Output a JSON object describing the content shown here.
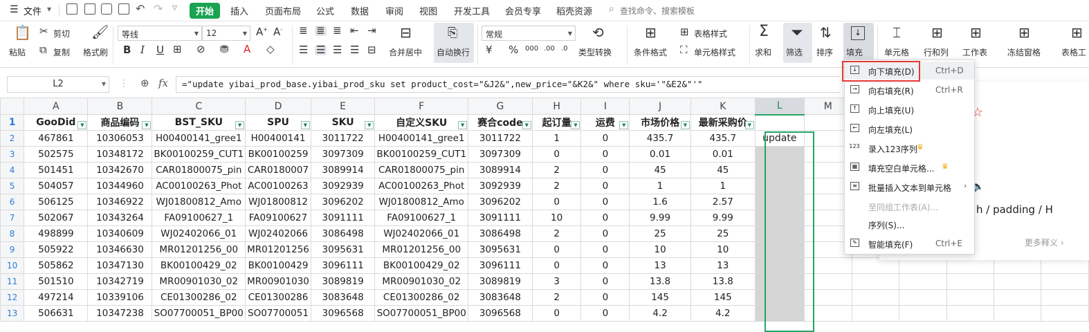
{
  "menubar": {
    "file_label": "文件",
    "tabs": [
      {
        "label": "开始",
        "active": true
      },
      {
        "label": "插入"
      },
      {
        "label": "页面布局"
      },
      {
        "label": "公式"
      },
      {
        "label": "数据"
      },
      {
        "label": "审阅"
      },
      {
        "label": "视图"
      },
      {
        "label": "开发工具"
      },
      {
        "label": "会员专享"
      },
      {
        "label": "稻壳资源"
      }
    ],
    "search_placeholder": "查找命令、搜索模板",
    "accent": "#1aa350"
  },
  "ribbon": {
    "paste": "粘贴",
    "cut": "剪切",
    "copy": "复制",
    "format_painter": "格式刷",
    "font_name": "等线",
    "font_size": "12",
    "merge": "合并居中",
    "wrap": "自动换行",
    "number_format": "常规",
    "type_convert": "类型转换",
    "cond_format": "条件格式",
    "table_style": "表格样式",
    "cell_style": "单元格样式",
    "sum": "求和",
    "filter": "筛选",
    "sort": "排序",
    "fill": "填充",
    "cell": "单元格",
    "row_col": "行和列",
    "worksheet": "工作表",
    "freeze": "冻结窗格",
    "table_tools": "表格工"
  },
  "formula_bar": {
    "name_box": "L2",
    "fx": "fx",
    "formula": "=\"update yibai_prod_base.yibai_prod_sku set product_cost=\"&J2&\",new_price=\"&K2&\" where sku='\"&E2&\"'\""
  },
  "sheet": {
    "columns": [
      "A",
      "B",
      "C",
      "D",
      "E",
      "F",
      "G",
      "H",
      "I",
      "J",
      "K",
      "L",
      "M"
    ],
    "headers": [
      "GooDid",
      "商品编码",
      "BST_SKU",
      "SPU",
      "SKU",
      "自定义SKU",
      "赛合code",
      "起订量",
      "运费",
      "市场价格",
      "最新采购价"
    ],
    "rows": [
      [
        "2",
        "467861",
        "10306053",
        "H00400141_gree1",
        "H00400141",
        "3011722",
        "H00400141_gree1",
        "3011722",
        "1",
        "0",
        "435.7",
        "435.7",
        "update"
      ],
      [
        "3",
        "502575",
        "10348172",
        "BK00100259_CUT1",
        "BK00100259",
        "3097309",
        "BK00100259_CUT1",
        "3097309",
        "0",
        "0",
        "0.01",
        "0.01",
        ""
      ],
      [
        "4",
        "501451",
        "10342670",
        "CAR01800075_pin",
        "CAR0180007",
        "3089914",
        "CAR01800075_pin",
        "3089914",
        "2",
        "0",
        "45",
        "45",
        ""
      ],
      [
        "5",
        "504057",
        "10344960",
        "AC00100263_Phot",
        "AC00100263",
        "3092939",
        "AC00100263_Phot",
        "3092939",
        "2",
        "0",
        "1",
        "1",
        ""
      ],
      [
        "6",
        "506125",
        "10346922",
        "WJ01800812_Amo",
        "WJ01800812",
        "3096202",
        "WJ01800812_Amo",
        "3096202",
        "0",
        "0",
        "1.6",
        "2.57",
        ""
      ],
      [
        "7",
        "502067",
        "10343264",
        "FA09100627_1",
        "FA09100627",
        "3091111",
        "FA09100627_1",
        "3091111",
        "10",
        "0",
        "9.99",
        "9.99",
        ""
      ],
      [
        "8",
        "498899",
        "10340609",
        "WJ02402066_01",
        "WJ02402066",
        "3086498",
        "WJ02402066_01",
        "3086498",
        "2",
        "0",
        "25",
        "25",
        ""
      ],
      [
        "9",
        "505922",
        "10346630",
        "MR01201256_00",
        "MR01201256",
        "3095631",
        "MR01201256_00",
        "3095631",
        "0",
        "0",
        "10",
        "10",
        ""
      ],
      [
        "10",
        "505862",
        "10347130",
        "BK00100429_02",
        "BK00100429",
        "3096111",
        "BK00100429_02",
        "3096111",
        "0",
        "0",
        "13",
        "13",
        ""
      ],
      [
        "11",
        "501510",
        "10342719",
        "MR00901030_02",
        "MR00901030",
        "3089819",
        "MR00901030_02",
        "3089819",
        "3",
        "0",
        "13.8",
        "13.8",
        ""
      ],
      [
        "12",
        "497214",
        "10339106",
        "CE01300286_02",
        "CE01300286",
        "3083648",
        "CE01300286_02",
        "3083648",
        "2",
        "0",
        "145",
        "145",
        ""
      ],
      [
        "13",
        "506631",
        "10347238",
        "SO07700051_BP00",
        "SO07700051",
        "3096568",
        "SO07700051_BP00",
        "3096568",
        "0",
        "0",
        "4.2",
        "4.2",
        ""
      ]
    ]
  },
  "fill_menu": {
    "items": [
      {
        "label": "向下填充(D)",
        "shortcut": "Ctrl+D",
        "icon": "↓"
      },
      {
        "label": "向右填充(R)",
        "shortcut": "Ctrl+R",
        "icon": "→"
      },
      {
        "label": "向上填充(U)",
        "shortcut": "",
        "icon": "↑"
      },
      {
        "label": "向左填充(L)",
        "shortcut": "",
        "icon": "←"
      },
      {
        "label": "录入123序列",
        "shortcut": "",
        "icon": "123",
        "crown": true
      },
      {
        "label": "填充空白单元格...",
        "shortcut": "",
        "icon": "▦",
        "crown": true
      },
      {
        "label": "批量插入文本到单元格",
        "shortcut": "",
        "icon": "≡",
        "submenu": true
      },
      {
        "label": "至同组工作表(A)...",
        "shortcut": "",
        "icon": "",
        "disabled": true
      },
      {
        "label": "序列(S)...",
        "shortcut": "",
        "icon": ""
      },
      {
        "label": "智能填充(F)",
        "shortcut": "Ctrl+E",
        "icon": "✎"
      }
    ]
  },
  "side_panel": {
    "text": "h / padding / H",
    "more": "更多释义"
  }
}
